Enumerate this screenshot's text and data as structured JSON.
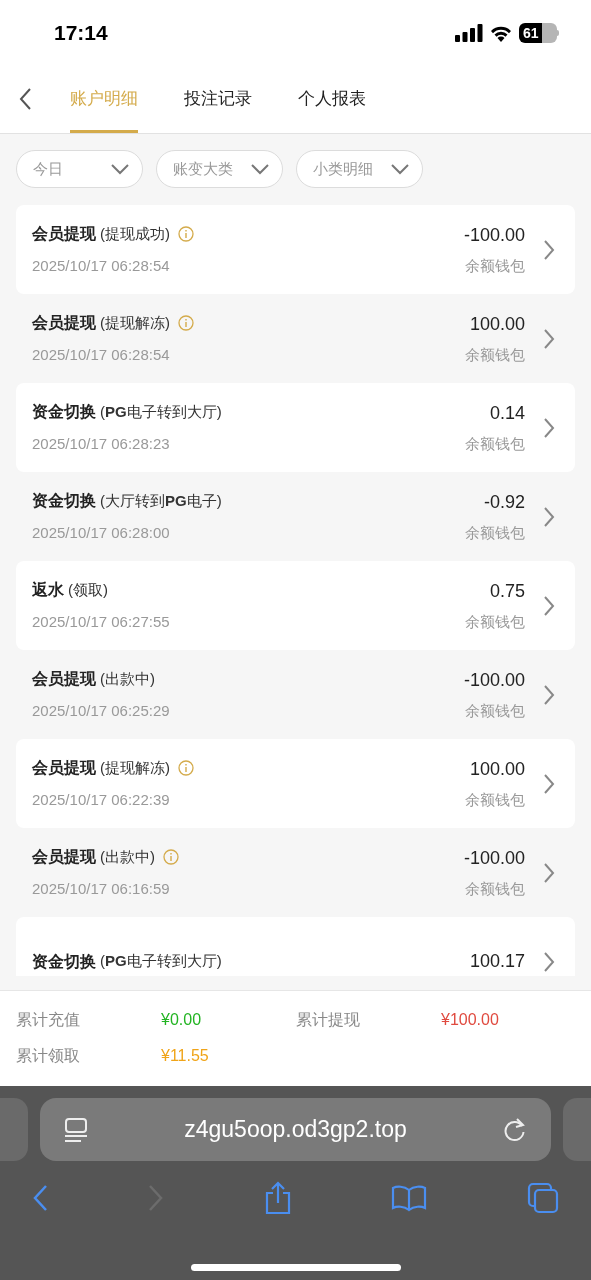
{
  "status_bar": {
    "time": "17:14",
    "battery": "61"
  },
  "tabs": [
    {
      "label": "账户明细",
      "selected": true
    },
    {
      "label": "投注记录",
      "selected": false
    },
    {
      "label": "个人报表",
      "selected": false
    }
  ],
  "filters": [
    "今日",
    "账变大类",
    "小类明细"
  ],
  "records": [
    {
      "title": "会员提现",
      "detail": "(提现成功)",
      "info": true,
      "date": "2025/10/17 06:28:54",
      "amount": "-100.00",
      "wallet": "余额钱包"
    },
    {
      "title": "会员提现",
      "detail": "(提现解冻)",
      "info": true,
      "date": "2025/10/17 06:28:54",
      "amount": "100.00",
      "wallet": "余额钱包"
    },
    {
      "title": "资金切换",
      "detail": "(**PG**电子转到大厅)",
      "info": false,
      "date": "2025/10/17 06:28:23",
      "amount": "0.14",
      "wallet": "余额钱包"
    },
    {
      "title": "资金切换",
      "detail": "(大厅转到**PG**电子)",
      "info": false,
      "date": "2025/10/17 06:28:00",
      "amount": "-0.92",
      "wallet": "余额钱包"
    },
    {
      "title": "返水",
      "detail": "(领取)",
      "info": false,
      "date": "2025/10/17 06:27:55",
      "amount": "0.75",
      "wallet": "余额钱包"
    },
    {
      "title": "会员提现",
      "detail": "(出款中)",
      "info": false,
      "date": "2025/10/17 06:25:29",
      "amount": "-100.00",
      "wallet": "余额钱包"
    },
    {
      "title": "会员提现",
      "detail": "(提现解冻)",
      "info": true,
      "date": "2025/10/17 06:22:39",
      "amount": "100.00",
      "wallet": "余额钱包"
    },
    {
      "title": "会员提现",
      "detail": "(出款中)",
      "info": true,
      "date": "2025/10/17 06:16:59",
      "amount": "-100.00",
      "wallet": "余额钱包"
    },
    {
      "title": "资金切换",
      "detail": "(**PG**电子转到大厅)",
      "info": false,
      "amount": "100.17"
    }
  ],
  "summary": [
    {
      "label": "累计充值",
      "value": "¥0.00",
      "color": "#22b422"
    },
    {
      "label": "累计提现",
      "value": "¥100.00",
      "color": "#e04a3f"
    },
    {
      "label": "累计领取",
      "value": "¥11.55",
      "color": "#f0a418"
    }
  ],
  "browser": {
    "url": "z4gu5oop.od3gp2.top"
  }
}
